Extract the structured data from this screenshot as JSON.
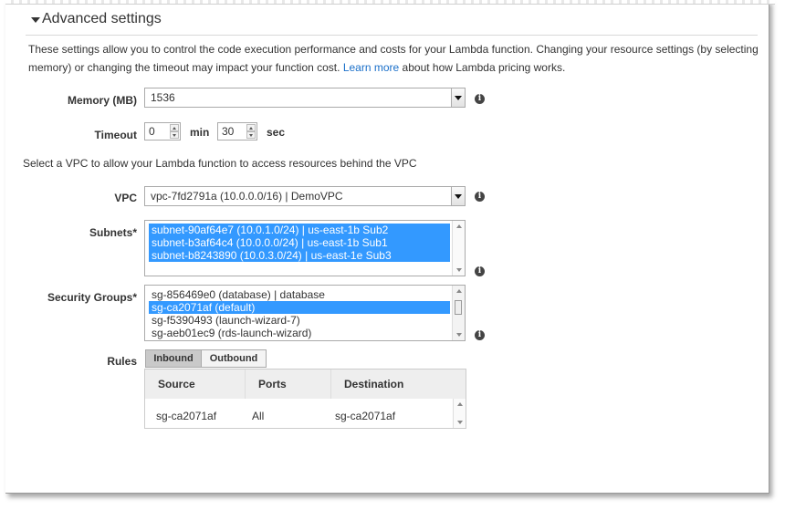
{
  "section": {
    "title": "Advanced settings"
  },
  "description": {
    "text": "These settings allow you to control the code execution performance and costs for your Lambda function. Changing your resource settings (by selecting memory) or changing the timeout may impact your function cost.",
    "link_text": "Learn more",
    "tail": "about how Lambda pricing works."
  },
  "memory": {
    "label": "Memory (MB)",
    "value": "1536"
  },
  "timeout": {
    "label": "Timeout",
    "min_value": "0",
    "min_unit": "min",
    "sec_value": "30",
    "sec_unit": "sec"
  },
  "vpc_note": "Select a VPC to allow your Lambda function to access resources behind the VPC",
  "vpc": {
    "label": "VPC",
    "value": "vpc-7fd2791a (10.0.0.0/16) | DemoVPC"
  },
  "subnets": {
    "label": "Subnets*",
    "options": [
      {
        "text": "subnet-90af64e7 (10.0.1.0/24) | us-east-1b Sub2",
        "selected": true
      },
      {
        "text": "subnet-b3af64c4 (10.0.0.0/24) | us-east-1b Sub1",
        "selected": true
      },
      {
        "text": "subnet-b8243890 (10.0.3.0/24) | us-east-1e Sub3",
        "selected": true
      }
    ]
  },
  "security_groups": {
    "label": "Security Groups*",
    "options": [
      {
        "text": "sg-856469e0 (database) | database",
        "selected": false
      },
      {
        "text": "sg-ca2071af (default)",
        "selected": true
      },
      {
        "text": "sg-f5390493 (launch-wizard-7)",
        "selected": false
      },
      {
        "text": "sg-aeb01ec9 (rds-launch-wizard)",
        "selected": false
      }
    ]
  },
  "rules": {
    "label": "Rules",
    "tabs": [
      {
        "label": "Inbound",
        "active": true
      },
      {
        "label": "Outbound",
        "active": false
      }
    ],
    "columns": [
      "Source",
      "Ports",
      "Destination"
    ],
    "rows": [
      [
        "sg-ca2071af",
        "All",
        "sg-ca2071af"
      ]
    ]
  },
  "colors": {
    "link": "#1a6fc9",
    "selection": "#3399ff"
  },
  "icons": [
    "collapse-caret-icon",
    "info-icon",
    "dropdown-arrow-icon",
    "spinner-arrows-icon",
    "scroll-arrow-icon"
  ]
}
